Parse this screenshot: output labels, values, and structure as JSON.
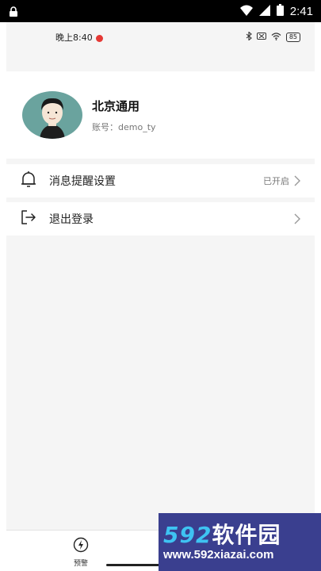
{
  "system_status": {
    "time": "2:41"
  },
  "inner_status": {
    "time": "晚上8:40",
    "battery": "85"
  },
  "profile": {
    "name": "北京通用",
    "account": "账号：demo_ty"
  },
  "menu": [
    {
      "label": "消息提醒设置",
      "status": "已开启"
    },
    {
      "label": "退出登录",
      "status": ""
    }
  ],
  "tabbar": {
    "alert_label": "预警"
  },
  "watermark": {
    "brand_num": "592",
    "brand_text": "软件园",
    "url": "www.592xiazai.com"
  },
  "colors": {
    "avatar_bg": "#6aa39e",
    "watermark_bg": "#3a3f8f",
    "watermark_accent": "#3ec3f2",
    "record_dot": "#e53935"
  }
}
